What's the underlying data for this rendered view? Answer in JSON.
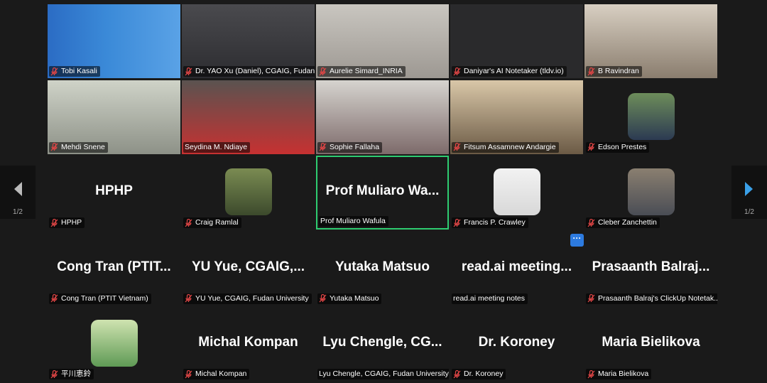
{
  "navigation": {
    "prev_page_label": "1/2",
    "next_page_label": "1/2"
  },
  "colors": {
    "active_speaker_border": "#2ecc71",
    "muted_icon": "#e04646",
    "next_arrow": "#3aa0e8",
    "more_button": "#2d7be0"
  },
  "participants": [
    {
      "name": "Tobi Kasali",
      "big_name": "",
      "muted": true,
      "kind": "video"
    },
    {
      "name": "Dr. YAO Xu (Daniel), CGAIG, Fudan...",
      "big_name": "",
      "muted": true,
      "kind": "video"
    },
    {
      "name": "Aurelie Simard_INRIA",
      "big_name": "",
      "muted": true,
      "kind": "video"
    },
    {
      "name": "Daniyar's AI Notetaker (tldv.io)",
      "big_name": "",
      "muted": true,
      "kind": "video"
    },
    {
      "name": "B Ravindran",
      "big_name": "",
      "muted": true,
      "kind": "video"
    },
    {
      "name": "Mehdi Snene",
      "big_name": "",
      "muted": true,
      "kind": "video"
    },
    {
      "name": "Seydina M. Ndiaye",
      "big_name": "",
      "muted": false,
      "kind": "video"
    },
    {
      "name": "Sophie Fallaha",
      "big_name": "",
      "muted": true,
      "kind": "video"
    },
    {
      "name": "Fitsum Assamnew Andargie",
      "big_name": "",
      "muted": true,
      "kind": "video"
    },
    {
      "name": "Edson Prestes",
      "big_name": "",
      "muted": true,
      "kind": "avatar"
    },
    {
      "name": "HPHP",
      "big_name": "HPHP",
      "muted": true,
      "kind": "name"
    },
    {
      "name": "Craig Ramlal",
      "big_name": "",
      "muted": true,
      "kind": "avatar"
    },
    {
      "name": "Prof Muliaro Wafula",
      "big_name": "Prof Muliaro Wa...",
      "muted": false,
      "kind": "name",
      "active": true
    },
    {
      "name": "Francis P. Crawley",
      "big_name": "",
      "muted": true,
      "kind": "avatar"
    },
    {
      "name": "Cleber Zanchettin",
      "big_name": "",
      "muted": true,
      "kind": "avatar"
    },
    {
      "name": "Cong Tran (PTIT Vietnam)",
      "big_name": "Cong Tran (PTIT...",
      "muted": true,
      "kind": "name"
    },
    {
      "name": "YU Yue, CGAIG, Fudan University",
      "big_name": "YU Yue, CGAIG,...",
      "muted": true,
      "kind": "name"
    },
    {
      "name": "Yutaka Matsuo",
      "big_name": "Yutaka Matsuo",
      "muted": true,
      "kind": "name"
    },
    {
      "name": "read.ai meeting notes",
      "big_name": "read.ai meeting...",
      "muted": false,
      "kind": "name"
    },
    {
      "name": "Prasaanth Balraj's ClickUp Notetak...",
      "big_name": "Prasaanth Balraj...",
      "muted": true,
      "kind": "name"
    },
    {
      "name": "平川恵鈴",
      "big_name": "",
      "muted": true,
      "kind": "avatar"
    },
    {
      "name": "Michal Kompan",
      "big_name": "Michal Kompan",
      "muted": true,
      "kind": "name"
    },
    {
      "name": "Lyu Chengle, CGAIG, Fudan University",
      "big_name": "Lyu Chengle, CG...",
      "muted": false,
      "kind": "name"
    },
    {
      "name": "Dr. Koroney",
      "big_name": "Dr. Koroney",
      "muted": true,
      "kind": "name"
    },
    {
      "name": "Maria Bielikova",
      "big_name": "Maria Bielikova",
      "muted": true,
      "kind": "name"
    }
  ],
  "more_button_label": "···"
}
